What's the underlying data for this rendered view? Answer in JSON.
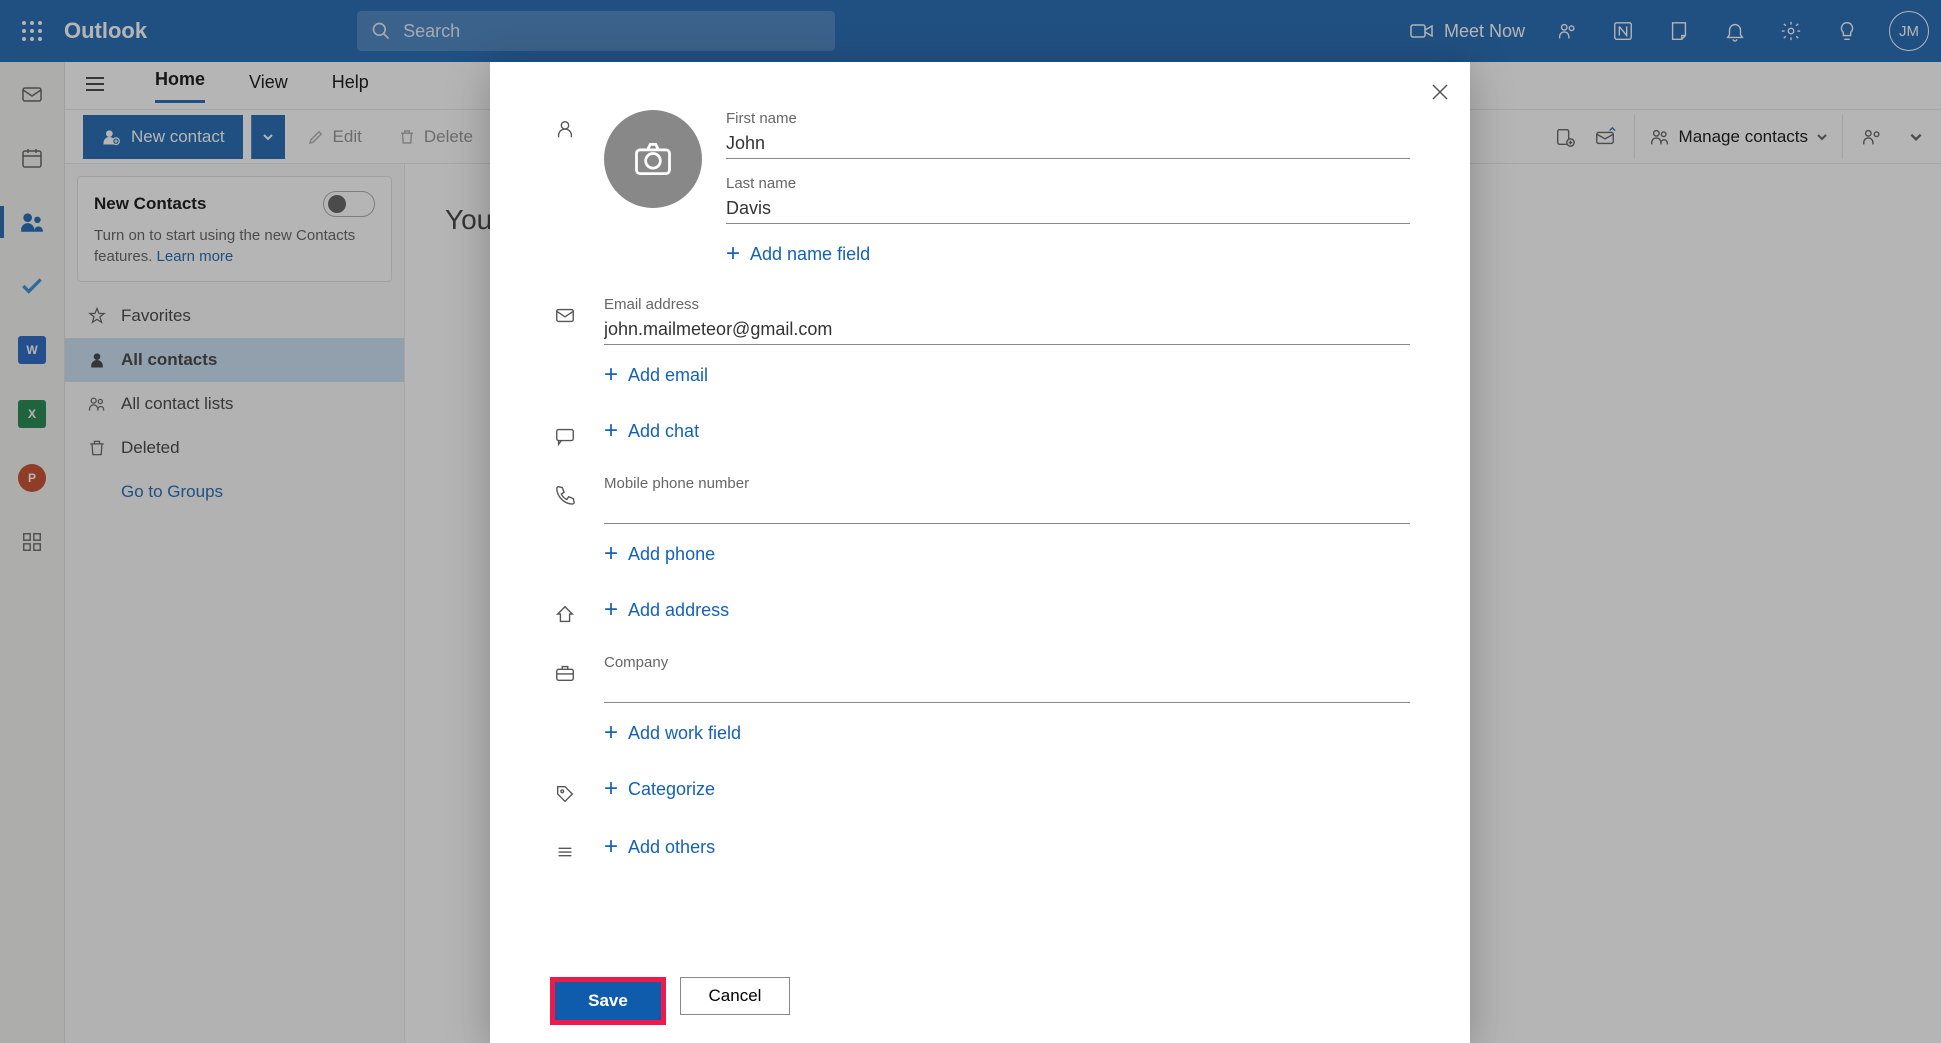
{
  "topbar": {
    "brand": "Outlook",
    "search_placeholder": "Search",
    "meet_now": "Meet Now",
    "avatar_initials": "JM"
  },
  "nav": {
    "tabs": [
      "Home",
      "View",
      "Help"
    ],
    "active_tab_index": 0
  },
  "toolbar": {
    "new_contact": "New contact",
    "edit": "Edit",
    "delete": "Delete",
    "manage_contacts": "Manage contacts"
  },
  "banner": {
    "title": "New Contacts",
    "text_prefix": "Turn on to start using the new Contacts features.  ",
    "learn_more": "Learn more"
  },
  "sidebar": {
    "items": [
      {
        "label": "Favorites",
        "icon": "star"
      },
      {
        "label": "All contacts",
        "icon": "person",
        "active": true
      },
      {
        "label": "All contact lists",
        "icon": "people"
      },
      {
        "label": "Deleted",
        "icon": "trash"
      }
    ],
    "groups_link": "Go to Groups"
  },
  "main": {
    "partial_text": "You"
  },
  "modal": {
    "first_name_label": "First name",
    "first_name_value": "John",
    "last_name_label": "Last name",
    "last_name_value": "Davis",
    "add_name_field": "Add name field",
    "email_label": "Email address",
    "email_value": "john.mailmeteor@gmail.com",
    "add_email": "Add email",
    "add_chat": "Add chat",
    "phone_label": "Mobile phone number",
    "phone_value": "",
    "add_phone": "Add phone",
    "add_address": "Add address",
    "company_label": "Company",
    "company_value": "",
    "add_work": "Add work field",
    "categorize": "Categorize",
    "add_others": "Add others",
    "save": "Save",
    "cancel": "Cancel"
  }
}
